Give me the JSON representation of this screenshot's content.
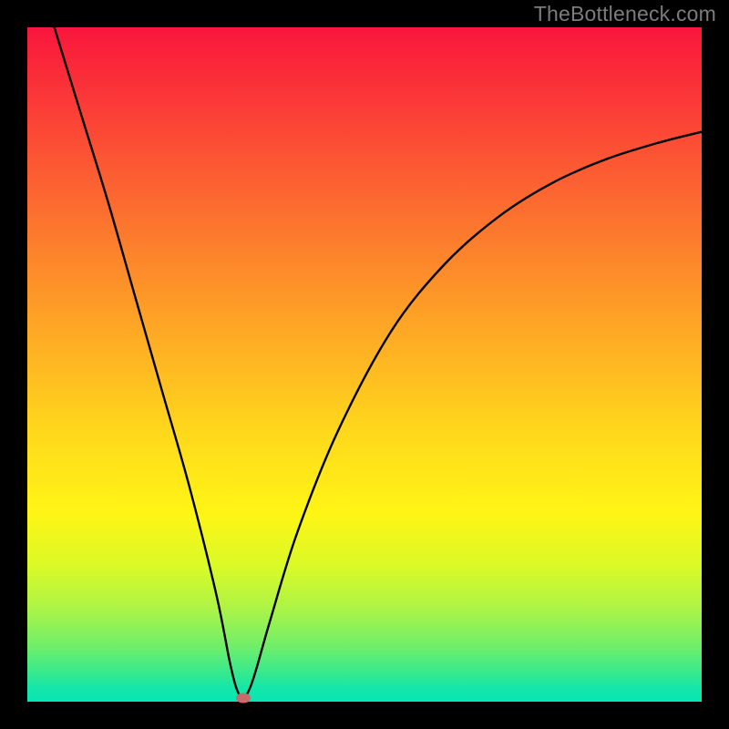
{
  "attribution": "TheBottleneck.com",
  "chart_data": {
    "type": "line",
    "title": "",
    "xlabel": "",
    "ylabel": "",
    "xlim": [
      0,
      100
    ],
    "ylim": [
      0,
      100
    ],
    "series": [
      {
        "name": "bottleneck-curve",
        "x": [
          4,
          8,
          12,
          16,
          20,
          24,
          28,
          30,
          31,
          32,
          33,
          34,
          36,
          40,
          46,
          54,
          62,
          70,
          78,
          86,
          94,
          100
        ],
        "values": [
          100,
          87,
          74,
          60,
          46,
          32,
          16,
          6,
          2,
          0.5,
          2,
          5,
          12,
          25,
          40,
          55,
          65,
          72,
          77,
          80.5,
          83,
          84.5
        ]
      }
    ],
    "marker": {
      "x": 32,
      "y": 0.5,
      "color": "#c96b6b"
    },
    "gradient_stops": [
      {
        "pos": 0,
        "color": "#f9163c"
      },
      {
        "pos": 24,
        "color": "#fc6431"
      },
      {
        "pos": 48,
        "color": "#feb223"
      },
      {
        "pos": 72,
        "color": "#fff515"
      },
      {
        "pos": 92,
        "color": "#6eee6b"
      },
      {
        "pos": 100,
        "color": "#08e5b5"
      }
    ]
  }
}
